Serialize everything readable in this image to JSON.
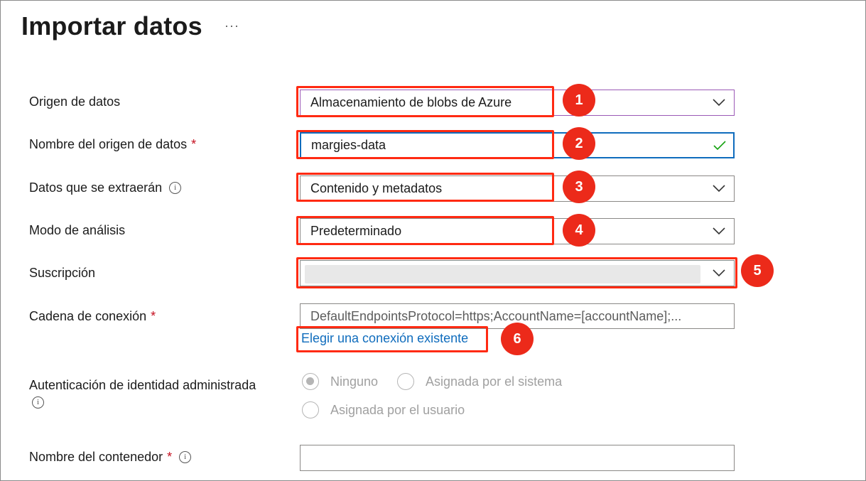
{
  "page": {
    "title": "Importar datos",
    "more": "···"
  },
  "fields": {
    "data_source": {
      "label": "Origen de datos",
      "value": "Almacenamiento de blobs de Azure"
    },
    "data_source_name": {
      "label": "Nombre del origen de datos",
      "required_mark": "*",
      "value": "margies-data"
    },
    "data_to_extract": {
      "label": "Datos que se extraerán",
      "info": "i",
      "value": "Contenido y metadatos"
    },
    "parsing_mode": {
      "label": "Modo de análisis",
      "value": "Predeterminado"
    },
    "subscription": {
      "label": "Suscripción",
      "value": ""
    },
    "connection_string": {
      "label": "Cadena de conexión",
      "required_mark": "*",
      "value": "DefaultEndpointsProtocol=https;AccountName=[accountName];...",
      "link": "Elegir una conexión existente"
    },
    "managed_identity": {
      "label": "Autenticación de identidad administrada",
      "info": "i",
      "options": [
        "Ninguno",
        "Asignada por el sistema",
        "Asignada por el usuario"
      ],
      "selected": "Ninguno"
    },
    "container_name": {
      "label": "Nombre del contenedor",
      "required_mark": "*",
      "info": "i",
      "value": ""
    }
  },
  "callouts": [
    "1",
    "2",
    "3",
    "4",
    "5",
    "6"
  ],
  "colors": {
    "highlight": "#ff2a12",
    "badge": "#ec2a1a",
    "link": "#0f6cbd",
    "required": "#c50f1f",
    "valid_check": "#13a10e"
  },
  "icons": {
    "dropdown": "chevron-down-icon",
    "valid": "checkmark-icon",
    "info": "info-icon"
  }
}
